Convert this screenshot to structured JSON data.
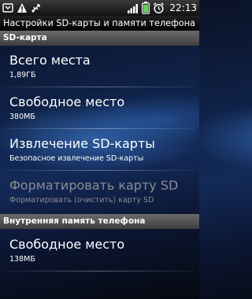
{
  "status_bar": {
    "time": "22:13",
    "left_icons": [
      "settings-icon",
      "warning-icon",
      "usb-icon"
    ],
    "right_icons": [
      "signal-icon",
      "battery-icon",
      "alarm-icon"
    ]
  },
  "title": "Настройки SD-карты и памяти телефона",
  "sections": [
    {
      "header": "SD-карта",
      "items": [
        {
          "title": "Всего места",
          "subtitle": "1,89ГБ",
          "enabled": true
        },
        {
          "title": "Свободное место",
          "subtitle": "380МБ",
          "enabled": true
        },
        {
          "title": "Извлечение SD-карты",
          "subtitle": "Безопасное извлечение SD-карты",
          "enabled": true
        },
        {
          "title": "Форматировать карту SD",
          "subtitle": "Форматировать (очистить) карту SD",
          "enabled": false
        }
      ]
    },
    {
      "header": "Внутренняя память телефона",
      "items": [
        {
          "title": "Свободное место",
          "subtitle": "138МБ",
          "enabled": true
        }
      ]
    }
  ]
}
